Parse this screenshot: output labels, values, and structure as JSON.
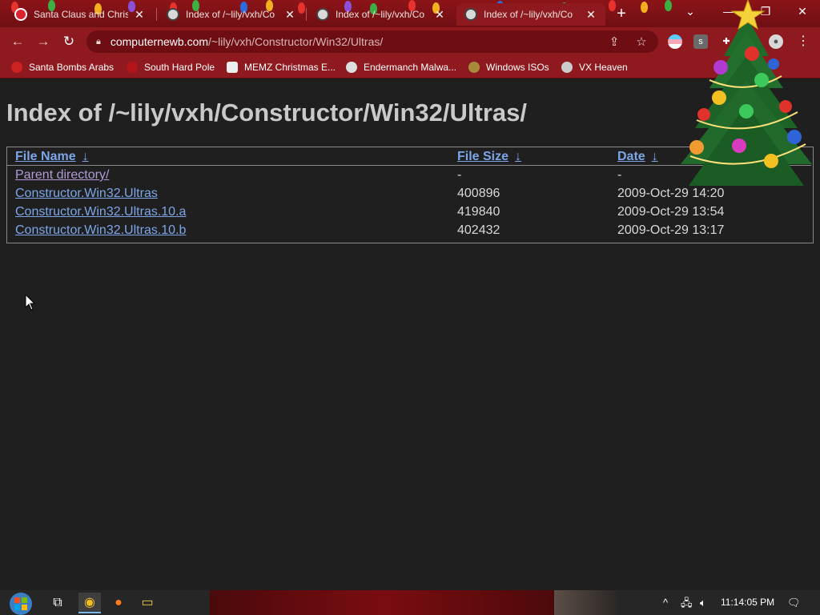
{
  "browser": {
    "tabs": [
      {
        "title": "Santa Claus and Christ",
        "active": false,
        "icon": "santa-icon"
      },
      {
        "title": "Index of /~lily/vxh/Co",
        "active": false,
        "icon": "vx-icon"
      },
      {
        "title": "Index of /~lily/vxh/Co",
        "active": false,
        "icon": "vx-icon"
      },
      {
        "title": "Index of /~lily/vxh/Co",
        "active": true,
        "icon": "vx-icon"
      }
    ],
    "new_tab_glyph": "+",
    "window_controls": {
      "dropdown": "⌄",
      "minimize": "—",
      "restore": "❐",
      "close": "✕"
    },
    "address": {
      "host": "computernewb.com",
      "path": "/~lily/vxh/Constructor/Win32/Ultras/"
    },
    "nav": {
      "back": "←",
      "forward": "→",
      "reload": "↻"
    },
    "bookmarks": [
      {
        "label": "Santa Bombs Arabs",
        "icon": "santa-icon"
      },
      {
        "label": "South Hard Pole",
        "icon": "snowflake-icon"
      },
      {
        "label": "MEMZ Christmas E...",
        "icon": "memz-icon"
      },
      {
        "label": "Endermanch Malwa...",
        "icon": "endermanch-icon"
      },
      {
        "label": "Windows ISOs",
        "icon": "windows-icon"
      },
      {
        "label": "VX Heaven",
        "icon": "vx-icon"
      }
    ]
  },
  "page": {
    "title": "Index of /~lily/vxh/Constructor/Win32/Ultras/",
    "columns": {
      "name": "File Name",
      "size": "File Size",
      "date": "Date",
      "sort_glyph": "↓"
    },
    "rows": [
      {
        "name": "Parent directory/",
        "size": "-",
        "date": "-",
        "is_parent": true
      },
      {
        "name": "Constructor.Win32.Ultras",
        "size": "400896",
        "date": "2009-Oct-29 14:20"
      },
      {
        "name": "Constructor.Win32.Ultras.10.a",
        "size": "419840",
        "date": "2009-Oct-29 13:54"
      },
      {
        "name": "Constructor.Win32.Ultras.10.b",
        "size": "402432",
        "date": "2009-Oct-29 13:17"
      }
    ]
  },
  "taskbar": {
    "items": [
      {
        "name": "task-view",
        "glyph": "⧉"
      },
      {
        "name": "chrome",
        "glyph": "◉",
        "active": true
      },
      {
        "name": "firefox",
        "glyph": "●"
      },
      {
        "name": "file-explorer",
        "glyph": "▭"
      }
    ],
    "clock": "11:14:05 PM"
  },
  "colors": {
    "chrome_red": "#8e1a1f",
    "link": "#7da6e8",
    "visited_link": "#b29bd8",
    "page_bg": "#1f1f1f",
    "heading": "#c9c9c9"
  }
}
